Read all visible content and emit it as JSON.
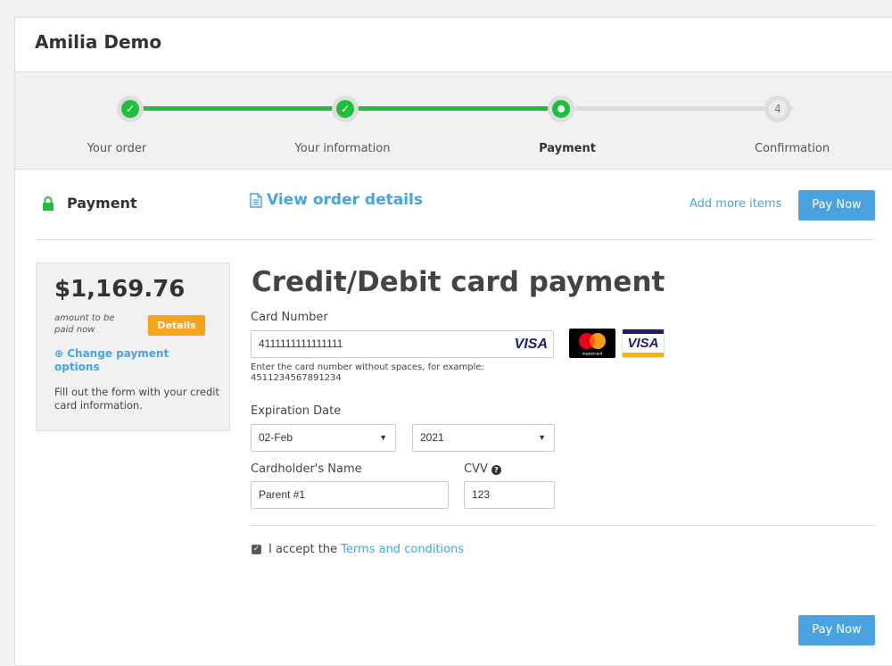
{
  "app": {
    "title": "Amilia Demo"
  },
  "stepper": {
    "steps": [
      {
        "label": "Your order",
        "state": "done",
        "marker": "✓"
      },
      {
        "label": "Your information",
        "state": "done",
        "marker": "✓"
      },
      {
        "label": "Payment",
        "state": "current",
        "marker": ""
      },
      {
        "label": "Confirmation",
        "state": "todo",
        "marker": "4"
      }
    ],
    "progress_color": "#1fbe3c"
  },
  "header": {
    "title": "Payment",
    "view_order_label": "View order details",
    "add_more_label": "Add more items",
    "pay_now_label": "Pay Now"
  },
  "summary": {
    "amount": "$1,169.76",
    "amount_note": "amount to be paid now",
    "details_label": "Details",
    "change_options_label": "⊕ Change payment options",
    "fill_note": "Fill out the form with your credit card information."
  },
  "form": {
    "title": "Credit/Debit card payment",
    "card_number_label": "Card Number",
    "card_number_value": "4111111111111111",
    "card_brand_detected": "VISA",
    "card_hint": "Enter the card number without spaces, for example: 4511234567891234",
    "expiration_label": "Expiration Date",
    "month_value": "02-Feb",
    "year_value": "2021",
    "cardholder_label": "Cardholder's Name",
    "cardholder_value": "Parent #1",
    "cvv_label": "CVV",
    "cvv_value": "123",
    "terms_prefix": "I accept the",
    "terms_link": "Terms and conditions",
    "terms_checked": true,
    "pay_now_label": "Pay Now",
    "accepted_cards": [
      "mastercard-logo",
      "visa-logo"
    ],
    "mastercard_caption": "mastercard",
    "visa_logo_text": "VISA"
  },
  "colors": {
    "accent": "#4aa3df",
    "success": "#1fbe3c",
    "details_button": "#f5a31a"
  }
}
